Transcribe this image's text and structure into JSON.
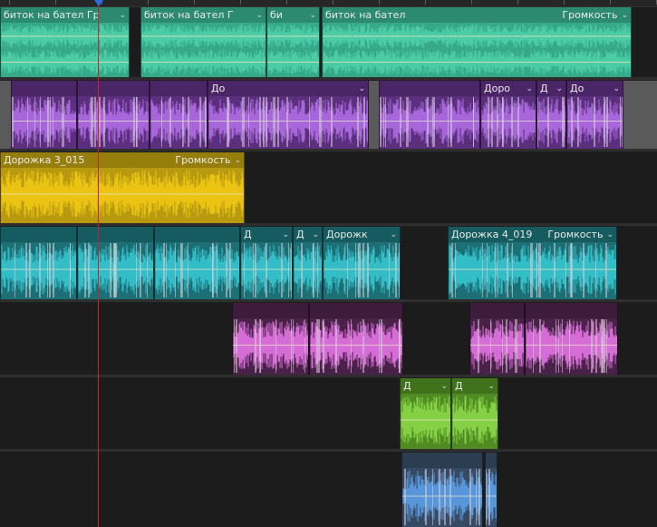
{
  "timeline": {
    "chevron": "⌄",
    "tracks": [
      {
        "id": "t1",
        "color": "#36a98a",
        "wave": "#4fd0a8",
        "clips": [
          {
            "name": "битoк на бател Гр",
            "volume": "",
            "chevron": true
          },
          {
            "name": "биток на бател Г",
            "volume": "",
            "chevron": true
          },
          {
            "name": "би",
            "volume": "",
            "chevron": true
          },
          {
            "name": "биток на бател",
            "volume": "Громкость",
            "chevron": true
          }
        ]
      },
      {
        "id": "t2",
        "color": "#5b2f7e",
        "wave": "#b06ee6",
        "clips": [
          {
            "name": "",
            "volume": "",
            "chevron": false
          },
          {
            "name": "",
            "volume": "",
            "chevron": false
          },
          {
            "name": "",
            "volume": "",
            "chevron": false
          },
          {
            "name": "До",
            "volume": "",
            "chevron": true
          },
          {
            "name": "",
            "volume": "",
            "chevron": false
          },
          {
            "name": "До",
            "volume": "",
            "chevron": false
          },
          {
            "name": "Доро",
            "volume": "",
            "chevron": true
          },
          {
            "name": "Д",
            "volume": "",
            "chevron": true
          },
          {
            "name": "До",
            "volume": "",
            "chevron": true
          }
        ]
      },
      {
        "id": "t3",
        "color": "#b89a10",
        "wave": "#f0c814",
        "clips": [
          {
            "name": "Дорожка 3_015",
            "volume": "Громкость",
            "chevron": true
          }
        ]
      },
      {
        "id": "t4",
        "color": "#1c6f74",
        "wave": "#36c6d0",
        "clips": [
          {
            "name": "",
            "volume": "",
            "chevron": false
          },
          {
            "name": "",
            "volume": "",
            "chevron": false
          },
          {
            "name": "",
            "volume": "",
            "chevron": false
          },
          {
            "name": "Д",
            "volume": "",
            "chevron": true
          },
          {
            "name": "Д",
            "volume": "",
            "chevron": true
          },
          {
            "name": "Дорожк",
            "volume": "",
            "chevron": true
          },
          {
            "name": "Дорожка 4_019",
            "volume": "Громкость",
            "chevron": true
          }
        ]
      },
      {
        "id": "t5",
        "color": "#4a2148",
        "wave": "#e676e6",
        "clips": [
          {
            "name": "",
            "volume": "",
            "chevron": false
          },
          {
            "name": "",
            "volume": "",
            "chevron": false
          },
          {
            "name": "",
            "volume": "",
            "chevron": false
          },
          {
            "name": "",
            "volume": "",
            "chevron": false
          }
        ]
      },
      {
        "id": "t6",
        "color": "#4f8a22",
        "wave": "#8bd848",
        "clips": [
          {
            "name": "Д",
            "volume": "",
            "chevron": true
          },
          {
            "name": "Д",
            "volume": "",
            "chevron": true
          }
        ]
      },
      {
        "id": "t7",
        "color": "#364a63",
        "wave": "#5a9fe6",
        "clips": [
          {
            "name": "",
            "volume": "",
            "chevron": false
          },
          {
            "name": "",
            "volume": "",
            "chevron": false
          }
        ]
      }
    ]
  }
}
